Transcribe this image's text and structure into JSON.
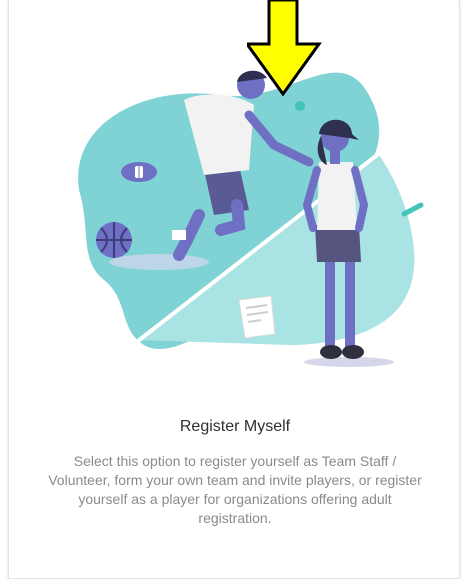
{
  "card": {
    "title": "Register Myself",
    "description": "Select this option to register yourself as Team Staff / Volunteer, form your own team and invite players, or register yourself as a player for organizations offering adult registration."
  },
  "colors": {
    "accent_teal": "#7fd3d5",
    "figure_purple": "#6f70c4",
    "arrow_yellow": "#ffff00"
  },
  "icons": [
    "football-icon",
    "basketball-icon",
    "paper-sheet-icon",
    "pencil-icon"
  ]
}
